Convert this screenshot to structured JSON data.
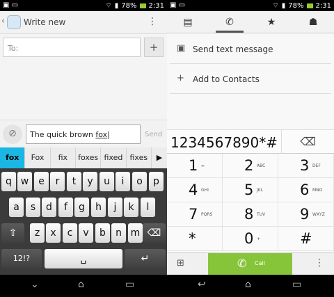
{
  "status": {
    "wifi_icon": "wifi-icon",
    "signal_icon": "signal-icon",
    "battery": "78%",
    "time": "2:31"
  },
  "messaging": {
    "back_glyph": "‹",
    "title": "Write new",
    "menu_glyph": "⋮",
    "to_placeholder": "To:",
    "add_contact_glyph": "+",
    "attach_glyph": "⊘",
    "message_text_prefix": "The quick brown ",
    "message_text_underlined": "fox",
    "send_label": "Send",
    "suggestions": [
      "fox",
      "Fox",
      "fix",
      "foxes",
      "fixed",
      "fixes"
    ],
    "suggest_more_glyph": "▶",
    "keyboard": {
      "row1": [
        "q",
        "w",
        "e",
        "r",
        "t",
        "y",
        "u",
        "i",
        "o",
        "p"
      ],
      "row2": [
        "a",
        "s",
        "d",
        "f",
        "g",
        "h",
        "j",
        "k",
        "l"
      ],
      "row3": [
        "z",
        "x",
        "c",
        "v",
        "b",
        "n",
        "m"
      ],
      "shift_glyph": "⇧",
      "backspace_glyph": "⌫",
      "symbols_label": "12!?",
      "space_glyph": "␣",
      "enter_glyph": "↵"
    }
  },
  "dialer": {
    "tabs": [
      "contacts",
      "phone",
      "favorites",
      "groups"
    ],
    "tab_glyphs": [
      "▤",
      "✆",
      "★",
      "☗"
    ],
    "options": [
      {
        "icon": "message-icon",
        "glyph": "▣",
        "label": "Send text message"
      },
      {
        "icon": "add-contact-icon",
        "glyph": "+",
        "label": "Add to Contacts"
      }
    ],
    "number": "1234567890*#",
    "delete_glyph": "⌫",
    "keys": [
      {
        "digit": "1",
        "letters": "∞"
      },
      {
        "digit": "2",
        "letters": "ABC"
      },
      {
        "digit": "3",
        "letters": "DEF"
      },
      {
        "digit": "4",
        "letters": "GHI"
      },
      {
        "digit": "5",
        "letters": "JKL"
      },
      {
        "digit": "6",
        "letters": "MNO"
      },
      {
        "digit": "7",
        "letters": "PQRS"
      },
      {
        "digit": "8",
        "letters": "TUV"
      },
      {
        "digit": "9",
        "letters": "WXYZ"
      },
      {
        "digit": "*",
        "letters": ""
      },
      {
        "digit": "0",
        "letters": "+"
      },
      {
        "digit": "#",
        "letters": ""
      }
    ],
    "keypad_glyph": "⊞",
    "call_glyph": "✆",
    "call_label": "Call",
    "more_glyph": "⋮"
  },
  "nav": {
    "back_glyph": "⌄",
    "home_glyph": "⌂",
    "recent_glyph": "▭",
    "back_glyph_right": "↩"
  }
}
